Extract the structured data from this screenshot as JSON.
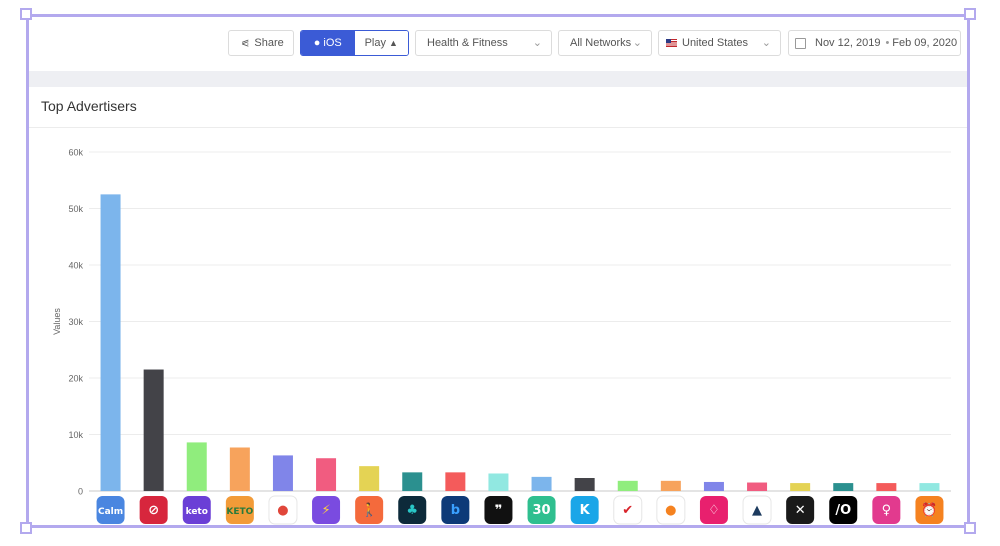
{
  "toolbar": {
    "share_label": "Share",
    "ios_label": "iOS",
    "play_label": "Play",
    "category": "Health & Fitness",
    "network": "All Networks",
    "country": "United States",
    "date_start": "Nov 12, 2019",
    "date_end": "Feb 09, 2020"
  },
  "card": {
    "title": "Top Advertisers"
  },
  "chart_data": {
    "type": "bar",
    "title": "Top Advertisers",
    "xlabel": "",
    "ylabel": "Values",
    "ylim": [
      0,
      60000
    ],
    "yticks": [
      "0",
      "10k",
      "20k",
      "30k",
      "40k",
      "50k",
      "60k"
    ],
    "grid": true,
    "values": [
      52500,
      21500,
      8600,
      7700,
      6300,
      5800,
      4400,
      3300,
      3300,
      3100,
      2500,
      2300,
      1800,
      1800,
      1600,
      1500,
      1400,
      1400,
      1400,
      1400
    ],
    "colors": [
      "#7cb5ec",
      "#434348",
      "#90ed7d",
      "#f7a35c",
      "#8085e9",
      "#f15c80",
      "#e4d354",
      "#2b908f",
      "#f45b5b",
      "#91e8e1",
      "#7cb5ec",
      "#434348",
      "#90ed7d",
      "#f7a35c",
      "#8085e9",
      "#f15c80",
      "#e4d354",
      "#2b908f",
      "#f45b5b",
      "#91e8e1"
    ],
    "icons": [
      {
        "name": "calm-icon",
        "bg": "#4a86e0",
        "fg": "#ffffff",
        "glyph": "Calm"
      },
      {
        "name": "peloton-icon",
        "bg": "#d7263d",
        "fg": "#ffffff",
        "glyph": "⊘"
      },
      {
        "name": "keto-icon",
        "bg": "#6b3fd6",
        "fg": "#ffffff",
        "glyph": "keto"
      },
      {
        "name": "keto-diet-icon",
        "bg": "#f29b38",
        "fg": "#2a7a3b",
        "glyph": "KETO"
      },
      {
        "name": "apple-fruit-icon",
        "bg": "#ffffff",
        "fg": "#e0463a",
        "glyph": "●"
      },
      {
        "name": "lightning-icon",
        "bg": "#7a4be0",
        "fg": "#ffd23c",
        "glyph": "⚡"
      },
      {
        "name": "walking-icon",
        "bg": "#f46a3c",
        "fg": "#ffffff",
        "glyph": "🚶"
      },
      {
        "name": "tree-icon",
        "bg": "#0d2a3a",
        "fg": "#29c7c7",
        "glyph": "♣"
      },
      {
        "name": "b-icon",
        "bg": "#0d3a78",
        "fg": "#3aa0ff",
        "glyph": "b"
      },
      {
        "name": "quote-icon",
        "bg": "#111111",
        "fg": "#ffffff",
        "glyph": "❞"
      },
      {
        "name": "30-day-icon",
        "bg": "#2fbf8f",
        "fg": "#ffffff",
        "glyph": "30"
      },
      {
        "name": "k-icon",
        "bg": "#1aa6e8",
        "fg": "#ffffff",
        "glyph": "K"
      },
      {
        "name": "red-check-icon",
        "bg": "#ffffff",
        "fg": "#d8232a",
        "glyph": "✔"
      },
      {
        "name": "orange-dot-icon",
        "bg": "#ffffff",
        "fg": "#f58220",
        "glyph": "●"
      },
      {
        "name": "drop-icon",
        "bg": "#e8206e",
        "fg": "#ffffff",
        "glyph": "♢"
      },
      {
        "name": "triangle-icon",
        "bg": "#ffffff",
        "fg": "#1c3a5e",
        "glyph": "▲"
      },
      {
        "name": "x-icon",
        "bg": "#1a1a1a",
        "fg": "#ffffff",
        "glyph": "✕"
      },
      {
        "name": "io-icon",
        "bg": "#000000",
        "fg": "#ffffff",
        "glyph": "/O"
      },
      {
        "name": "pregnancy-icon",
        "bg": "#e23a8e",
        "fg": "#ffffff",
        "glyph": "♀"
      },
      {
        "name": "alarm-icon",
        "bg": "#f58220",
        "fg": "#ffffff",
        "glyph": "⏰"
      }
    ]
  }
}
